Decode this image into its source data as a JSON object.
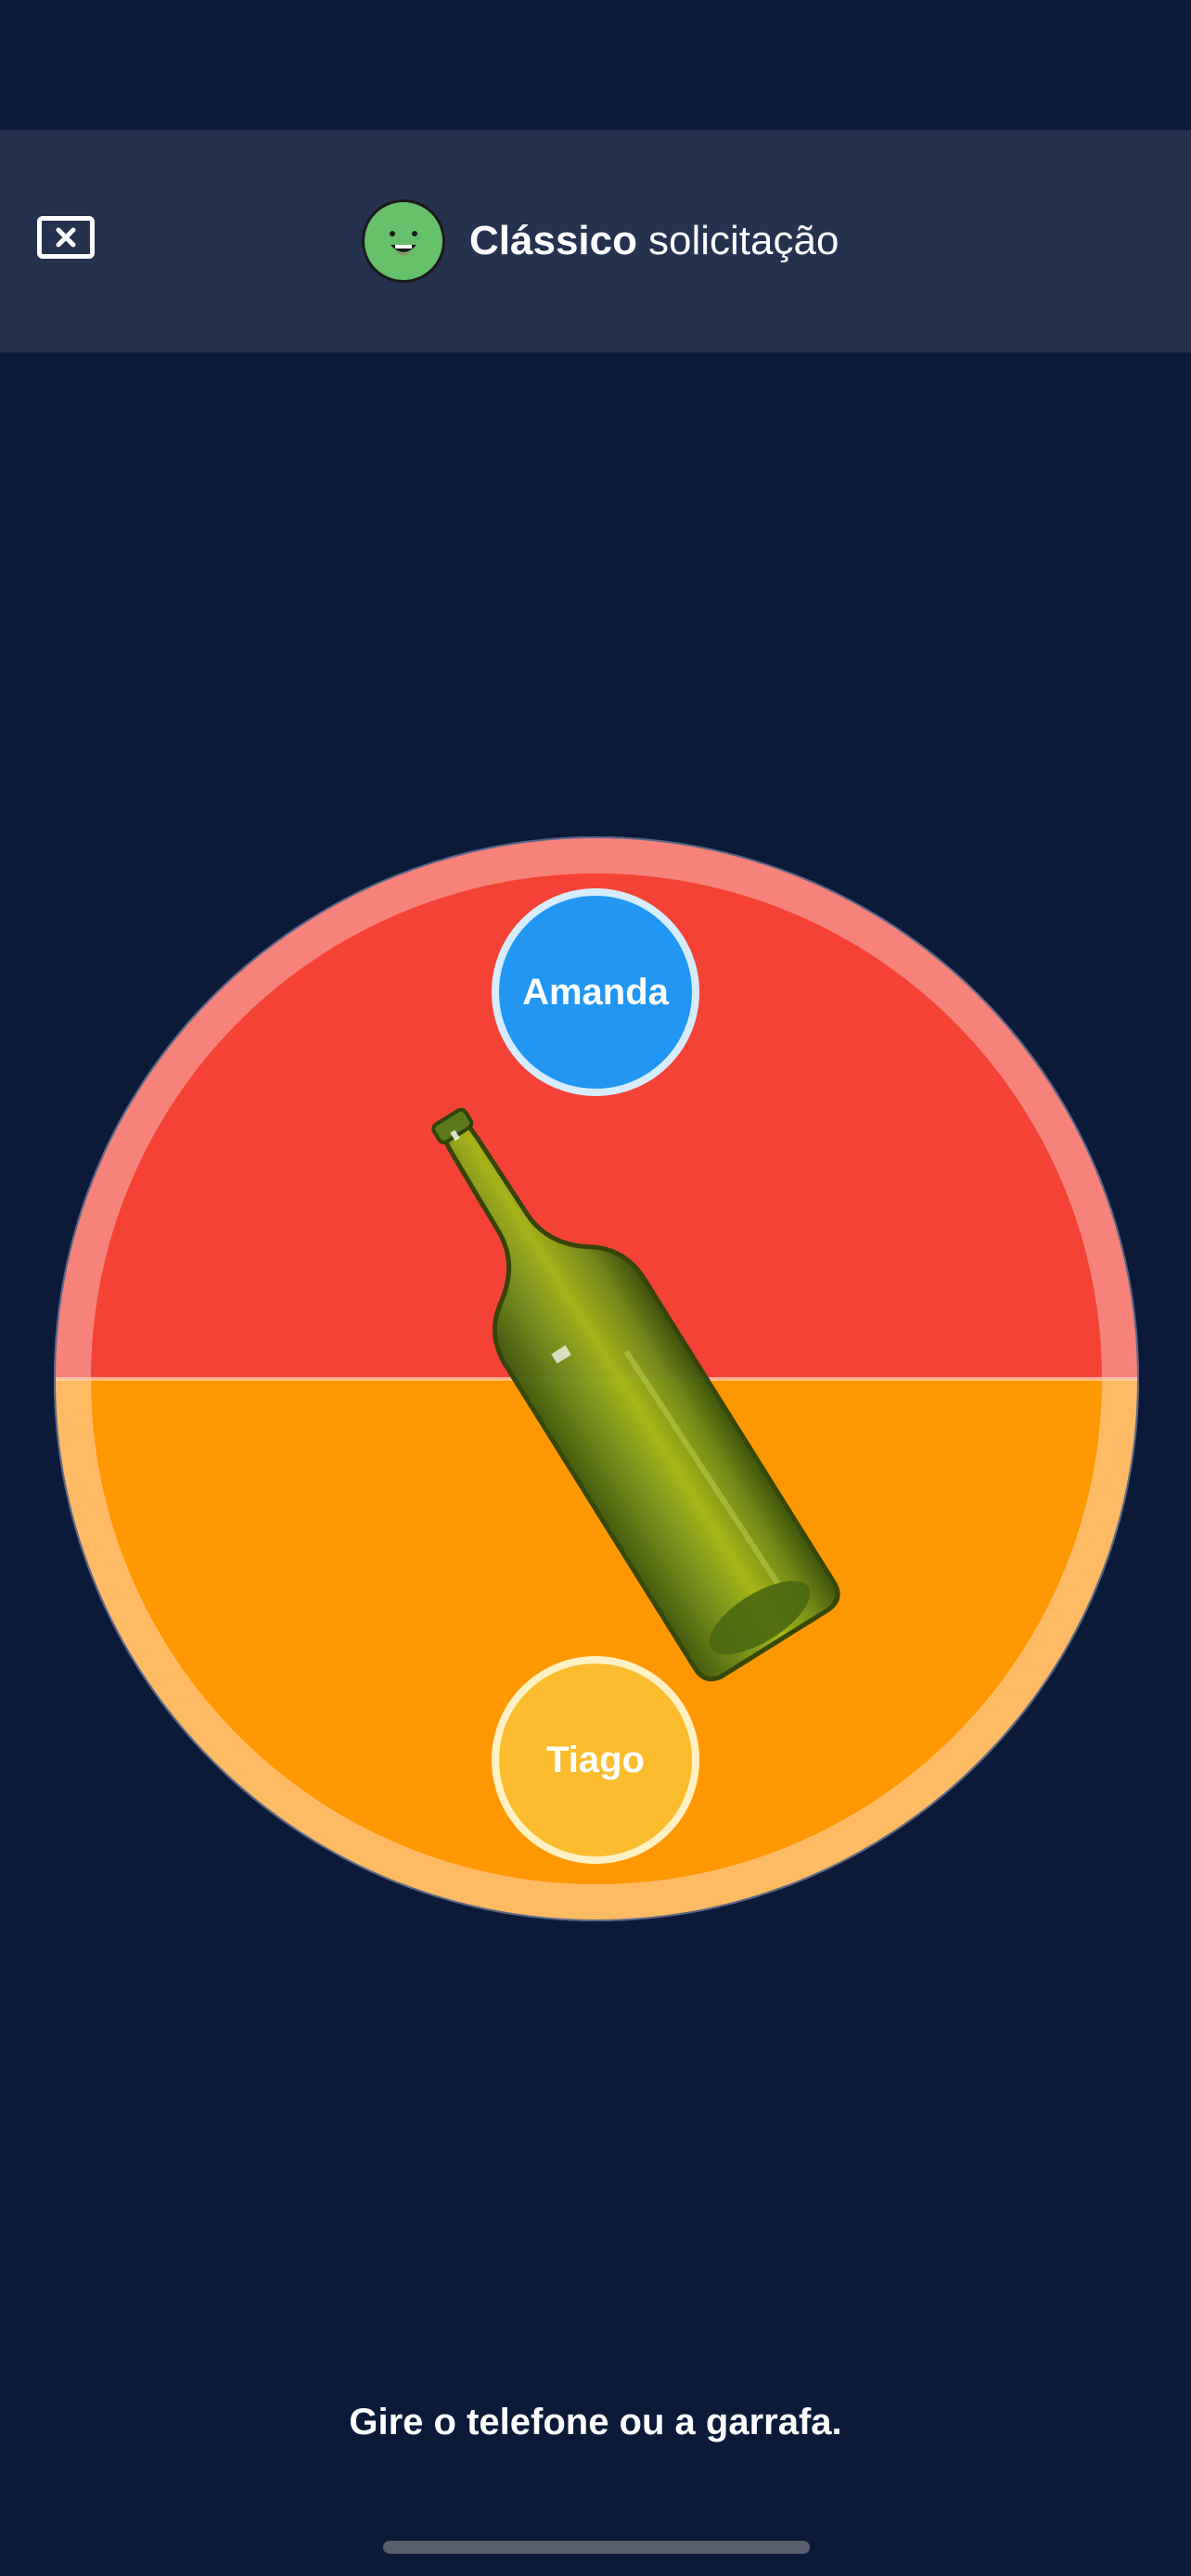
{
  "header": {
    "title_bold": "Clássico",
    "title_rest": "solicitação",
    "close_icon": "close-icon",
    "avatar_icon": "smiley-face-icon"
  },
  "wheel": {
    "top_segment_color": "#f44336",
    "bottom_segment_color": "#ff9800",
    "players": [
      {
        "name": "Amanda",
        "color": "#2196f3"
      },
      {
        "name": "Tiago",
        "color": "#fbbd2e"
      }
    ],
    "bottle_icon": "bottle-icon"
  },
  "footer": {
    "instruction": "Gire o telefone ou a garrafa."
  }
}
